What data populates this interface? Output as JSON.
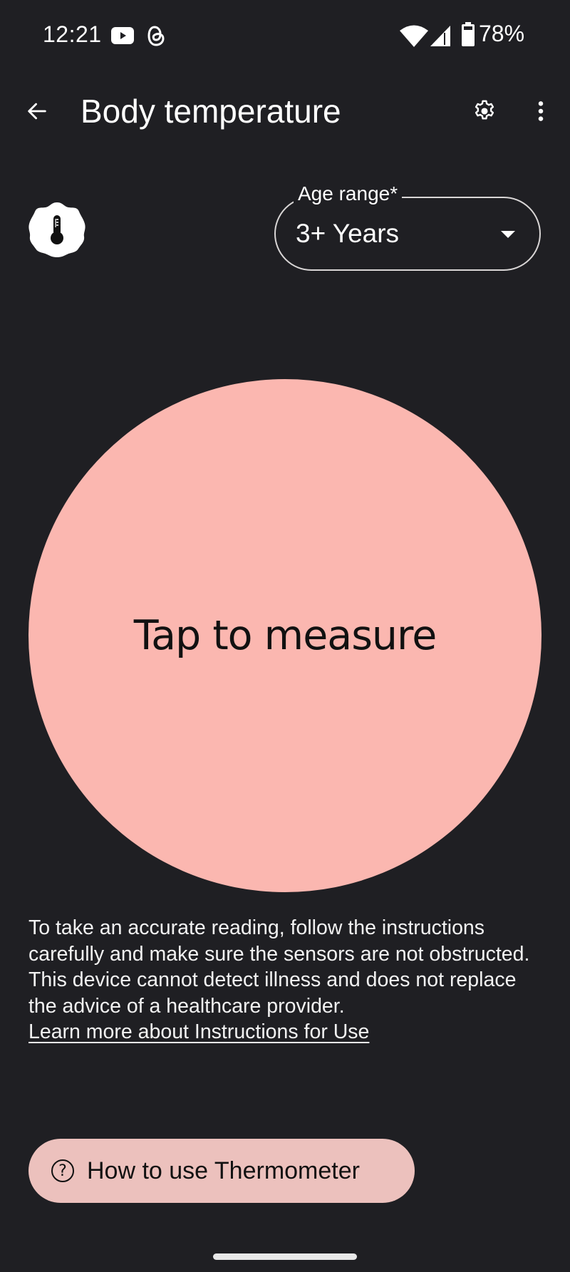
{
  "status_bar": {
    "time": "12:21",
    "notification_icons": [
      "youtube-icon",
      "threads-icon"
    ],
    "system_icons": [
      "wifi-icon",
      "cellular-signal-icon",
      "battery-icon"
    ],
    "battery_percent": "78%"
  },
  "app_bar": {
    "back_icon": "arrow-back-icon",
    "title": "Body temperature",
    "actions": [
      "settings-gear-icon",
      "more-vert-icon"
    ]
  },
  "badge": {
    "icon": "thermometer-icon"
  },
  "age_range": {
    "label": "Age range*",
    "selected": "3+ Years",
    "icon": "dropdown-caret-icon"
  },
  "measure": {
    "label": "Tap to measure",
    "color": "#fbb7b0"
  },
  "disclaimer": {
    "text": "To take an accurate reading, follow the instructions carefully and make sure the sensors are not obstructed. This device cannot detect illness and does not replace the advice of a healthcare provider.",
    "link_text": "Learn more about Instructions for Use"
  },
  "help_button": {
    "icon": "help-circle-icon",
    "icon_glyph": "?",
    "label": "How to use Thermometer",
    "color": "#ecc1bd"
  },
  "colors": {
    "background": "#1f1f23",
    "text": "#ffffff"
  }
}
